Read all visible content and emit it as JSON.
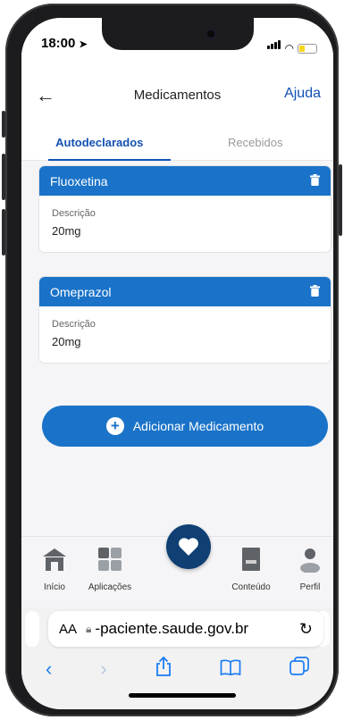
{
  "status_bar": {
    "time": "18:00"
  },
  "header": {
    "title": "Medicamentos",
    "help_label": "Ajuda"
  },
  "tabs": [
    {
      "label": "Autodeclarados",
      "active": true
    },
    {
      "label": "Recebidos",
      "active": false
    }
  ],
  "medications": [
    {
      "name": "Fluoxetina",
      "description_label": "Descrição",
      "description": "20mg"
    },
    {
      "name": "Omeprazol",
      "description_label": "Descrição",
      "description": "20mg"
    }
  ],
  "add_button_label": "Adicionar Medicamento",
  "bottom_nav": {
    "items": [
      {
        "label": "Início",
        "icon": "home-icon"
      },
      {
        "label": "Aplicações",
        "icon": "grid-icon"
      },
      {
        "label": "Conteúdo",
        "icon": "document-icon"
      },
      {
        "label": "Perfil",
        "icon": "user-icon"
      }
    ],
    "center_icon": "heart-icon"
  },
  "browser": {
    "text_size_label": "AA",
    "url": "-paciente.saude.gov.br"
  },
  "colors": {
    "primary": "#1a73c8",
    "dark": "#0f3f73",
    "link": "#1351b4"
  }
}
